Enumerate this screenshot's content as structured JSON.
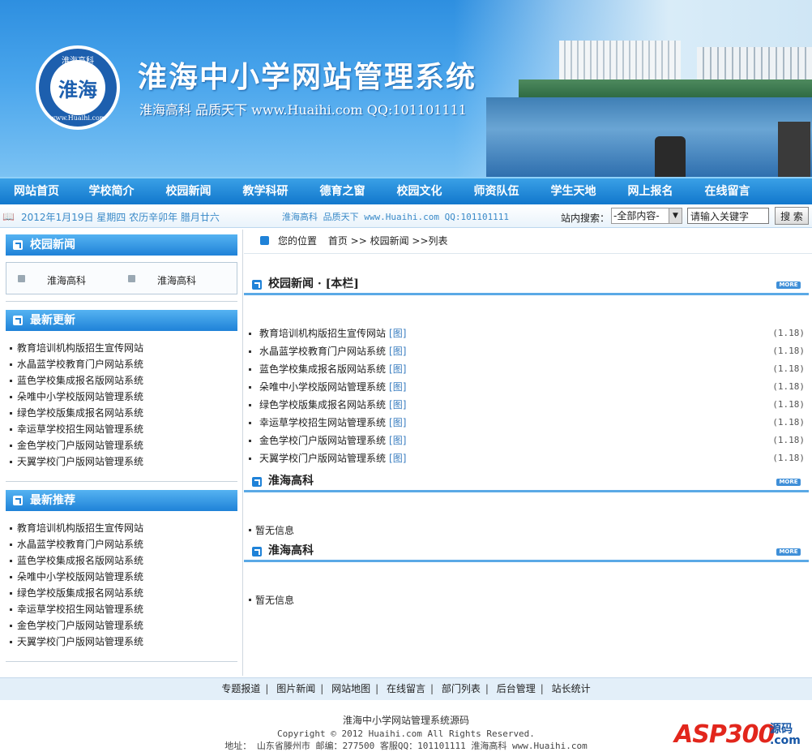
{
  "header": {
    "logo_text": "淮海",
    "logo_ring_top": "淮海高科",
    "logo_ring_bottom": "www.Huaihi.com",
    "title": "淮海中小学网站管理系统",
    "slogan": "淮海高科 品质天下 www.Huaihi.com QQ:101101111"
  },
  "nav": [
    "网站首页",
    "学校简介",
    "校园新闻",
    "教学科研",
    "德育之窗",
    "校园文化",
    "师资队伍",
    "学生天地",
    "网上报名",
    "在线留言"
  ],
  "infobar": {
    "date": "2012年1月19日 星期四 农历辛卯年 腊月廿六",
    "marquee": "淮海高科 品质天下 www.Huaihi.com QQ:101101111",
    "search_label": "站内搜索：",
    "search_scope": "-全部内容-",
    "search_value": "请输入关键字",
    "search_button": "搜 索"
  },
  "sidebar": {
    "section1": {
      "title": "校园新闻",
      "items": [
        "淮海高科",
        "淮海高科"
      ]
    },
    "section2": {
      "title": "最新更新",
      "items": [
        "教育培训机构版招生宣传网站",
        "水晶蓝学校教育门户网站系统",
        "蓝色学校集成报名版网站系统",
        "朵唯中小学校版网站管理系统",
        "绿色学校版集成报名网站系统",
        "幸运草学校招生网站管理系统",
        "金色学校门户版网站管理系统",
        "天翼学校门户版网站管理系统"
      ]
    },
    "section3": {
      "title": "最新推荐",
      "items": [
        "教育培训机构版招生宣传网站",
        "水晶蓝学校教育门户网站系统",
        "蓝色学校集成报名版网站系统",
        "朵唯中小学校版网站管理系统",
        "绿色学校版集成报名网站系统",
        "幸运草学校招生网站管理系统",
        "金色学校门户版网站管理系统",
        "天翼学校门户版网站管理系统"
      ]
    }
  },
  "breadcrumb": {
    "prefix": "您的位置",
    "path": "首页 >> 校园新闻 >>列表"
  },
  "main": {
    "section1": {
      "title": "校园新闻 · [本栏]",
      "more": "MORE",
      "items": [
        {
          "title": "教育培训机构版招生宣传网站",
          "tag": "[图]",
          "date": "(1.18)"
        },
        {
          "title": "水晶蓝学校教育门户网站系统",
          "tag": "[图]",
          "date": "(1.18)"
        },
        {
          "title": "蓝色学校集成报名版网站系统",
          "tag": "[图]",
          "date": "(1.18)"
        },
        {
          "title": "朵唯中小学校版网站管理系统",
          "tag": "[图]",
          "date": "(1.18)"
        },
        {
          "title": "绿色学校版集成报名网站系统",
          "tag": "[图]",
          "date": "(1.18)"
        },
        {
          "title": "幸运草学校招生网站管理系统",
          "tag": "[图]",
          "date": "(1.18)"
        },
        {
          "title": "金色学校门户版网站管理系统",
          "tag": "[图]",
          "date": "(1.18)"
        },
        {
          "title": "天翼学校门户版网站管理系统",
          "tag": "[图]",
          "date": "(1.18)"
        }
      ]
    },
    "section2": {
      "title": "淮海高科",
      "more": "MORE",
      "empty": "暂无信息"
    },
    "section3": {
      "title": "淮海高科",
      "more": "MORE",
      "empty": "暂无信息"
    }
  },
  "footer_links": [
    "专题报道",
    "图片新闻",
    "网站地图",
    "在线留言",
    "部门列表",
    "后台管理",
    "站长统计"
  ],
  "footer": {
    "line1": "淮海中小学网站管理系统源码",
    "line2": "Copyright © 2012 Huaihi.com All Rights Reserved.",
    "line3": "地址： 山东省滕州市 邮编：277500 客服QQ：101101111 淮海高科 www.Huaihi.com"
  },
  "watermark": {
    "brand": "ASP300",
    "suffix1": "源码",
    "suffix2": ".com"
  },
  "colors": {
    "primary": "#1f82d8",
    "nav": "#1177cc",
    "link": "#3a7ec0",
    "watermark": "#e2261c"
  }
}
